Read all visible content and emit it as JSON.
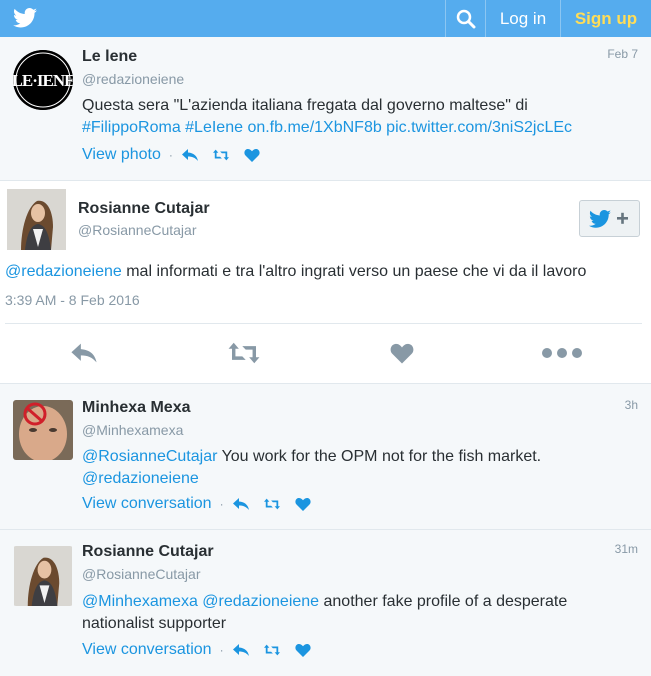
{
  "topbar": {
    "logo_icon": "twitter-bird-icon",
    "search_icon": "search-icon",
    "login_label": "Log in",
    "signup_label": "Sign up",
    "colors": {
      "bar": "#55acee",
      "signup": "#ffdd57"
    }
  },
  "tweets": [
    {
      "name": "Le lene",
      "handle": "@redazioneiene",
      "time": "Feb 7",
      "text_plain": "Questa sera \"L'azienda italiana fregata dal governo maltese\" di",
      "text_links": "#FilippoRoma #LeIene on.fb.me/1XbNF8b pic.twitter.com/3niS2jcLEc",
      "view_label": "View photo"
    },
    {
      "name": "Minhexa Mexa",
      "handle": "@Minhexamexa",
      "time": "3h",
      "mention_1": "@RosianneCutajar",
      "text_plain": " You work for the OPM not for the fish market.",
      "mention_2": "@redazioneiene",
      "view_label": "View conversation"
    },
    {
      "name": "Rosianne Cutajar",
      "handle": "@RosianneCutajar",
      "time": "31m",
      "mention_1": "@Minhexamexa",
      "mention_2": "@redazioneiene",
      "text_plain_1": " another fake profile of a desperate",
      "text_plain_2": "nationalist supporter",
      "view_label": "View conversation"
    }
  ],
  "focused": {
    "name": "Rosianne Cutajar",
    "handle": "@RosianneCutajar",
    "mention": "@redazioneiene",
    "text": " mal informati e tra l'altro ingrati verso un paese che vi da il lavoro",
    "timestamp": "3:39 AM - 8 Feb 2016",
    "follow_icon": "follow-bird-plus-icon",
    "actions": [
      "reply-icon",
      "retweet-icon",
      "like-icon",
      "more-icon"
    ]
  }
}
